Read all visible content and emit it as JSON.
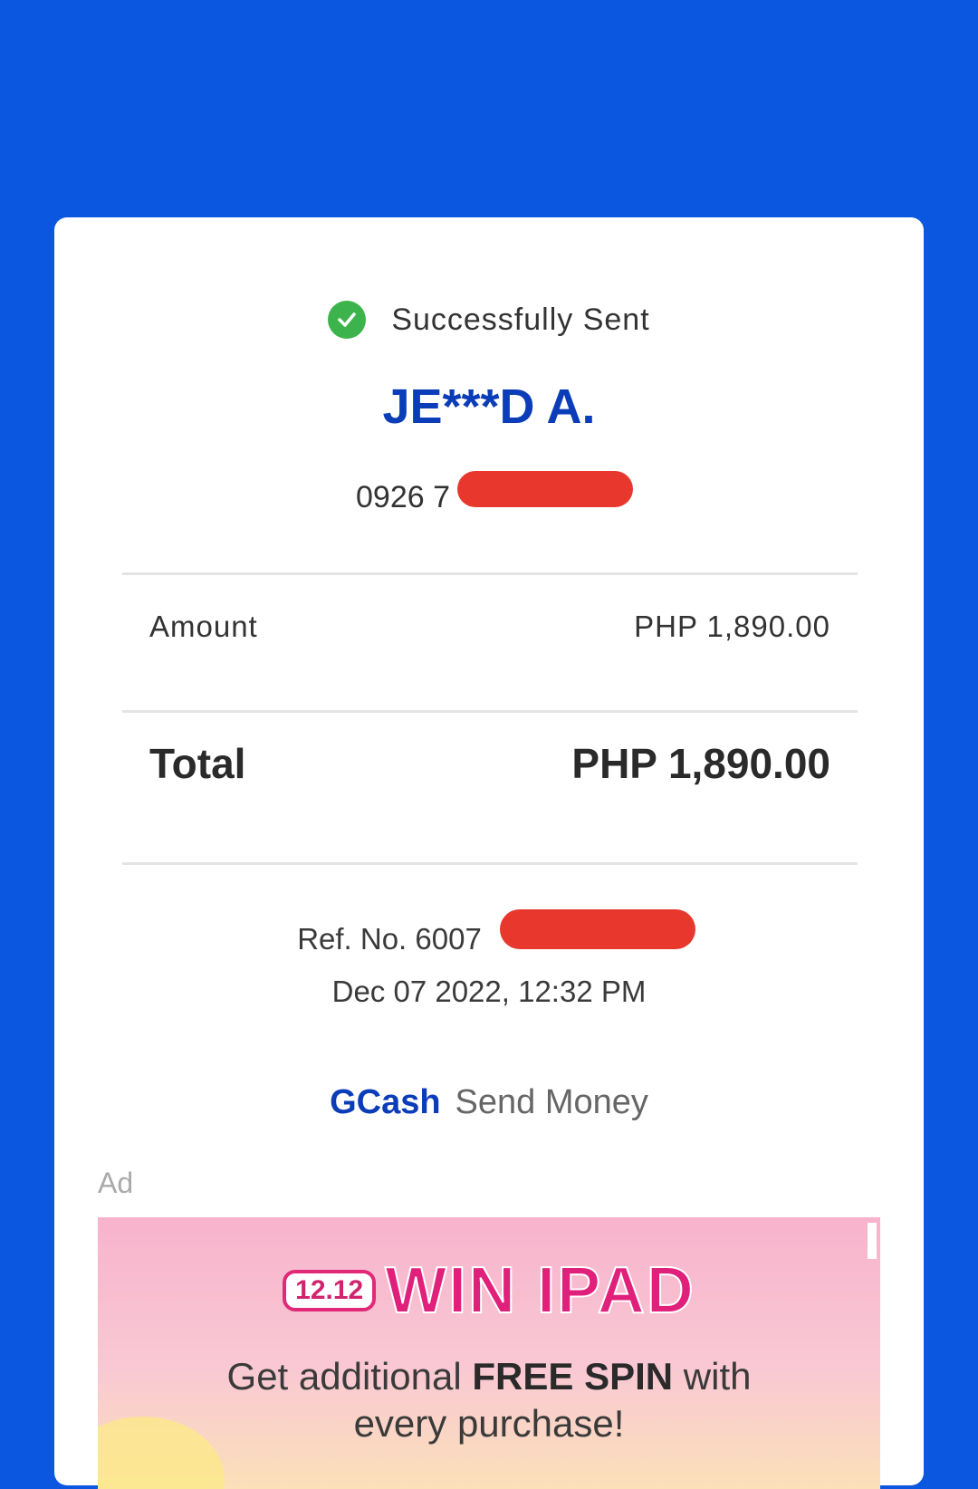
{
  "receipt": {
    "status": "Successfully Sent",
    "recipient_name": "JE***D A.",
    "phone_prefix": "0926 7",
    "amount_label": "Amount",
    "amount_value": "PHP 1,890.00",
    "total_label": "Total",
    "total_value": "PHP 1,890.00",
    "ref_prefix": "Ref. No. 6007",
    "datetime": "Dec 07 2022, 12:32 PM",
    "brand": "GCash",
    "service": "Send Money"
  },
  "ad": {
    "label": "Ad",
    "badge": "12.12",
    "title": "WIN IPAD",
    "line1_a": "Get additional ",
    "line1_bold": "FREE SPIN",
    "line1_b": " with",
    "line2": "every purchase!"
  },
  "colors": {
    "background": "#0b57e0",
    "accent": "#0b3db8",
    "success": "#3cb44b",
    "redaction": "#e8382d"
  }
}
